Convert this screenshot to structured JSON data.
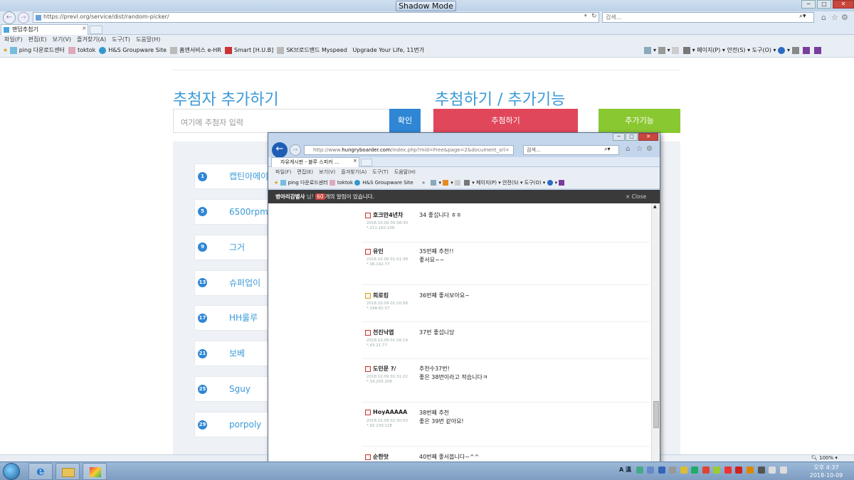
{
  "shadow_mode": "Shadow Mode",
  "browser": {
    "url": "https://prevl.org/service/dist/random-picker/",
    "search_placeholder": "검색...",
    "tab_title": "랜덤추첨기",
    "menu": [
      "파일(F)",
      "편집(E)",
      "보기(V)",
      "즐겨찾기(A)",
      "도구(T)",
      "도움말(H)"
    ],
    "favorites": [
      "ping 다운로드센터",
      "toktok",
      "H&S Groupware Site",
      "홈앤서비스 e-HR",
      "Smart [H.U.B]",
      "SK브로드밴드 Myspeed",
      "Upgrade Your Life, 11번가"
    ],
    "cmd": [
      "페이지(P) ▾",
      "안전(S) ▾",
      "도구(O) ▾"
    ],
    "zoom": "100%"
  },
  "page": {
    "left_heading": "추첨자 추가하기",
    "right_heading": "추첨하기 / 추가기능",
    "input_placeholder": "여기에 추첨자 입력",
    "confirm_btn": "확인",
    "draw_btn": "추첨하기",
    "extra_btn": "추가기능",
    "entries": [
      {
        "num": "1",
        "name": "캡틴아메이"
      },
      {
        "num": "5",
        "name": "6500rpm"
      },
      {
        "num": "9",
        "name": "그거"
      },
      {
        "num": "13",
        "name": "슈퍼업이"
      },
      {
        "num": "17",
        "name": "HH룰루"
      },
      {
        "num": "21",
        "name": "보베"
      },
      {
        "num": "25",
        "name": "Sguy"
      },
      {
        "num": "29",
        "name": "porpoly"
      }
    ]
  },
  "popup": {
    "url_prefix": "http://www.",
    "url_domain": "hungryboarder.com",
    "url_rest": "/index.php?mid=Free&page=2&document_srl=",
    "search_placeholder": "검색...",
    "tab_title": "자유게시판 - 블루 스피커 ...",
    "menu": [
      "파일(F)",
      "편집(E)",
      "보기(V)",
      "즐겨찾기(A)",
      "도구(T)",
      "도움말(H)"
    ],
    "favorites": [
      "ping 다운로드센터",
      "toktok",
      "H&S Groupware Site"
    ],
    "cmd": [
      "페이지(P) ▾",
      "안전(S) ▾",
      "도구(O) ▾"
    ],
    "notif_user": "병아리감별사",
    "notif_nim": "님!",
    "notif_count": "60",
    "notif_msg": "개의 알림이 있습니다.",
    "close": "× Close",
    "comments": [
      {
        "author": "호크만4년차",
        "date": "2018.10.09 00:38:30",
        "ip": "*.211.162.106",
        "lines": [
          "34 좋섭니다 ㅎㅎ"
        ]
      },
      {
        "author": "유인",
        "date": "2018.10.09 01:01:38",
        "ip": "*.36.142.77",
        "lines": [
          "35번째 추천!!",
          "좋서요~~"
        ]
      },
      {
        "author": "희로킹",
        "date": "2018.10.09 01:10:58",
        "ip": "*.198.81.57",
        "lines": [
          "36번째 좋서보아요~"
        ]
      },
      {
        "author": "전진낙엽",
        "date": "2018.10.09 01:16:19",
        "ip": "*.43.21.77",
        "lines": [
          "37번 좋섭니당"
        ]
      },
      {
        "author": "도민문 ?/",
        "date": "2018.10.09 01:31:22",
        "ip": "*.34.205.208",
        "lines": [
          "추천수37번!",
          "좋은 38번이라고 적습니다ㅋ"
        ]
      },
      {
        "author": "HoyAAAAA",
        "date": "2018.10.09 02:30:03",
        "ip": "*.92.239.128",
        "lines": [
          "38번째 추천",
          "좋은 39번 같아요!"
        ]
      },
      {
        "author": "순한맛",
        "date": "",
        "ip": "",
        "lines": [
          "40번째 좋서봅니다~^^"
        ]
      }
    ]
  },
  "taskbar": {
    "time": "오후 4:37",
    "date": "2018-10-09",
    "tray_lang": "A 漢"
  }
}
